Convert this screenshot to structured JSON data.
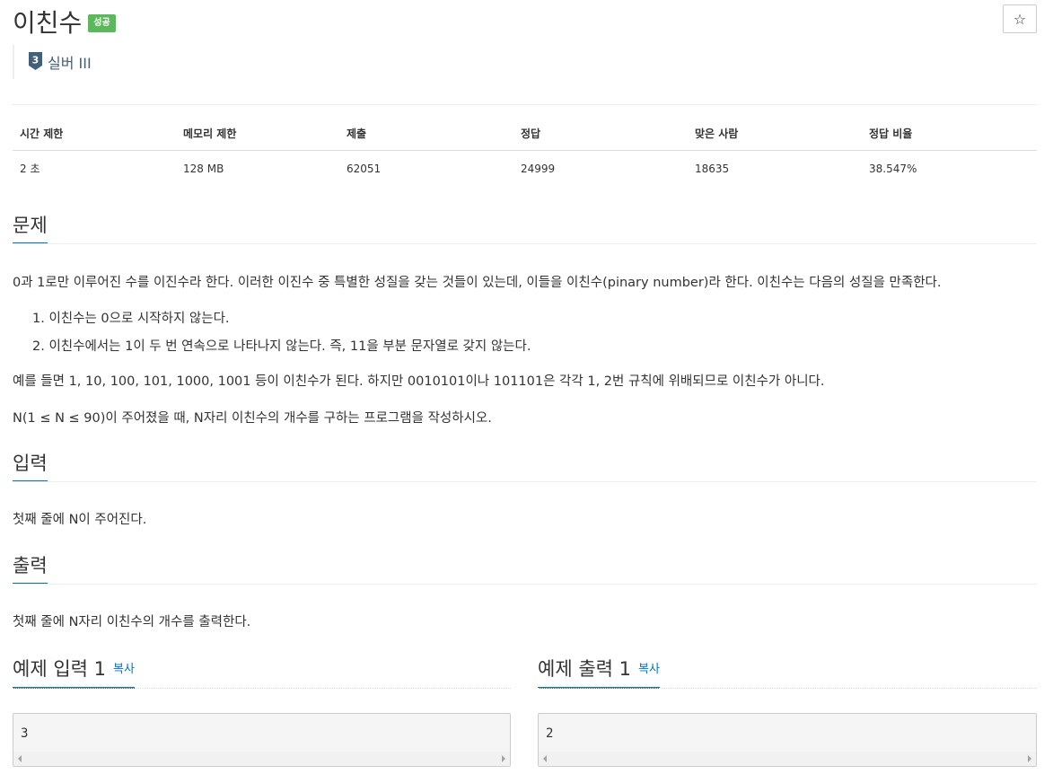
{
  "problem": {
    "title": "이친수",
    "result_badge": "성공",
    "star_icon": "☆",
    "tier": {
      "level": "3",
      "label": "실버 III",
      "color": "#435f7a"
    }
  },
  "stats": {
    "headers": [
      "시간 제한",
      "메모리 제한",
      "제출",
      "정답",
      "맞은 사람",
      "정답 비율"
    ],
    "values": [
      "2 초",
      "128 MB",
      "62051",
      "24999",
      "18635",
      "38.547%"
    ]
  },
  "sections": {
    "description": {
      "heading": "문제",
      "intro": "0과 1로만 이루어진 수를 이진수라 한다. 이러한 이진수 중 특별한 성질을 갖는 것들이 있는데, 이들을 이친수(pinary number)라 한다. 이친수는 다음의 성질을 만족한다.",
      "rules": [
        "1. 이친수는 0으로 시작하지 않는다.",
        "2. 이친수에서는 1이 두 번 연속으로 나타나지 않는다. 즉, 11을 부분 문자열로 갖지 않는다."
      ],
      "example": "예를 들면 1, 10, 100, 101, 1000, 1001 등이 이친수가 된다. 하지만 0010101이나 101101은 각각 1, 2번 규칙에 위배되므로 이친수가 아니다.",
      "task": "N(1 ≤ N ≤ 90)이 주어졌을 때, N자리 이친수의 개수를 구하는 프로그램을 작성하시오."
    },
    "input": {
      "heading": "입력",
      "text": "첫째 줄에 N이 주어진다."
    },
    "output": {
      "heading": "출력",
      "text": "첫째 줄에 N자리 이친수의 개수를 출력한다."
    }
  },
  "samples": {
    "input": {
      "heading": "예제 입력 1",
      "copy": "복사",
      "value": "3"
    },
    "output": {
      "heading": "예제 출력 1",
      "copy": "복사",
      "value": "2"
    }
  },
  "colors": {
    "accent": "#0076c0",
    "success": "#5cb85c"
  }
}
